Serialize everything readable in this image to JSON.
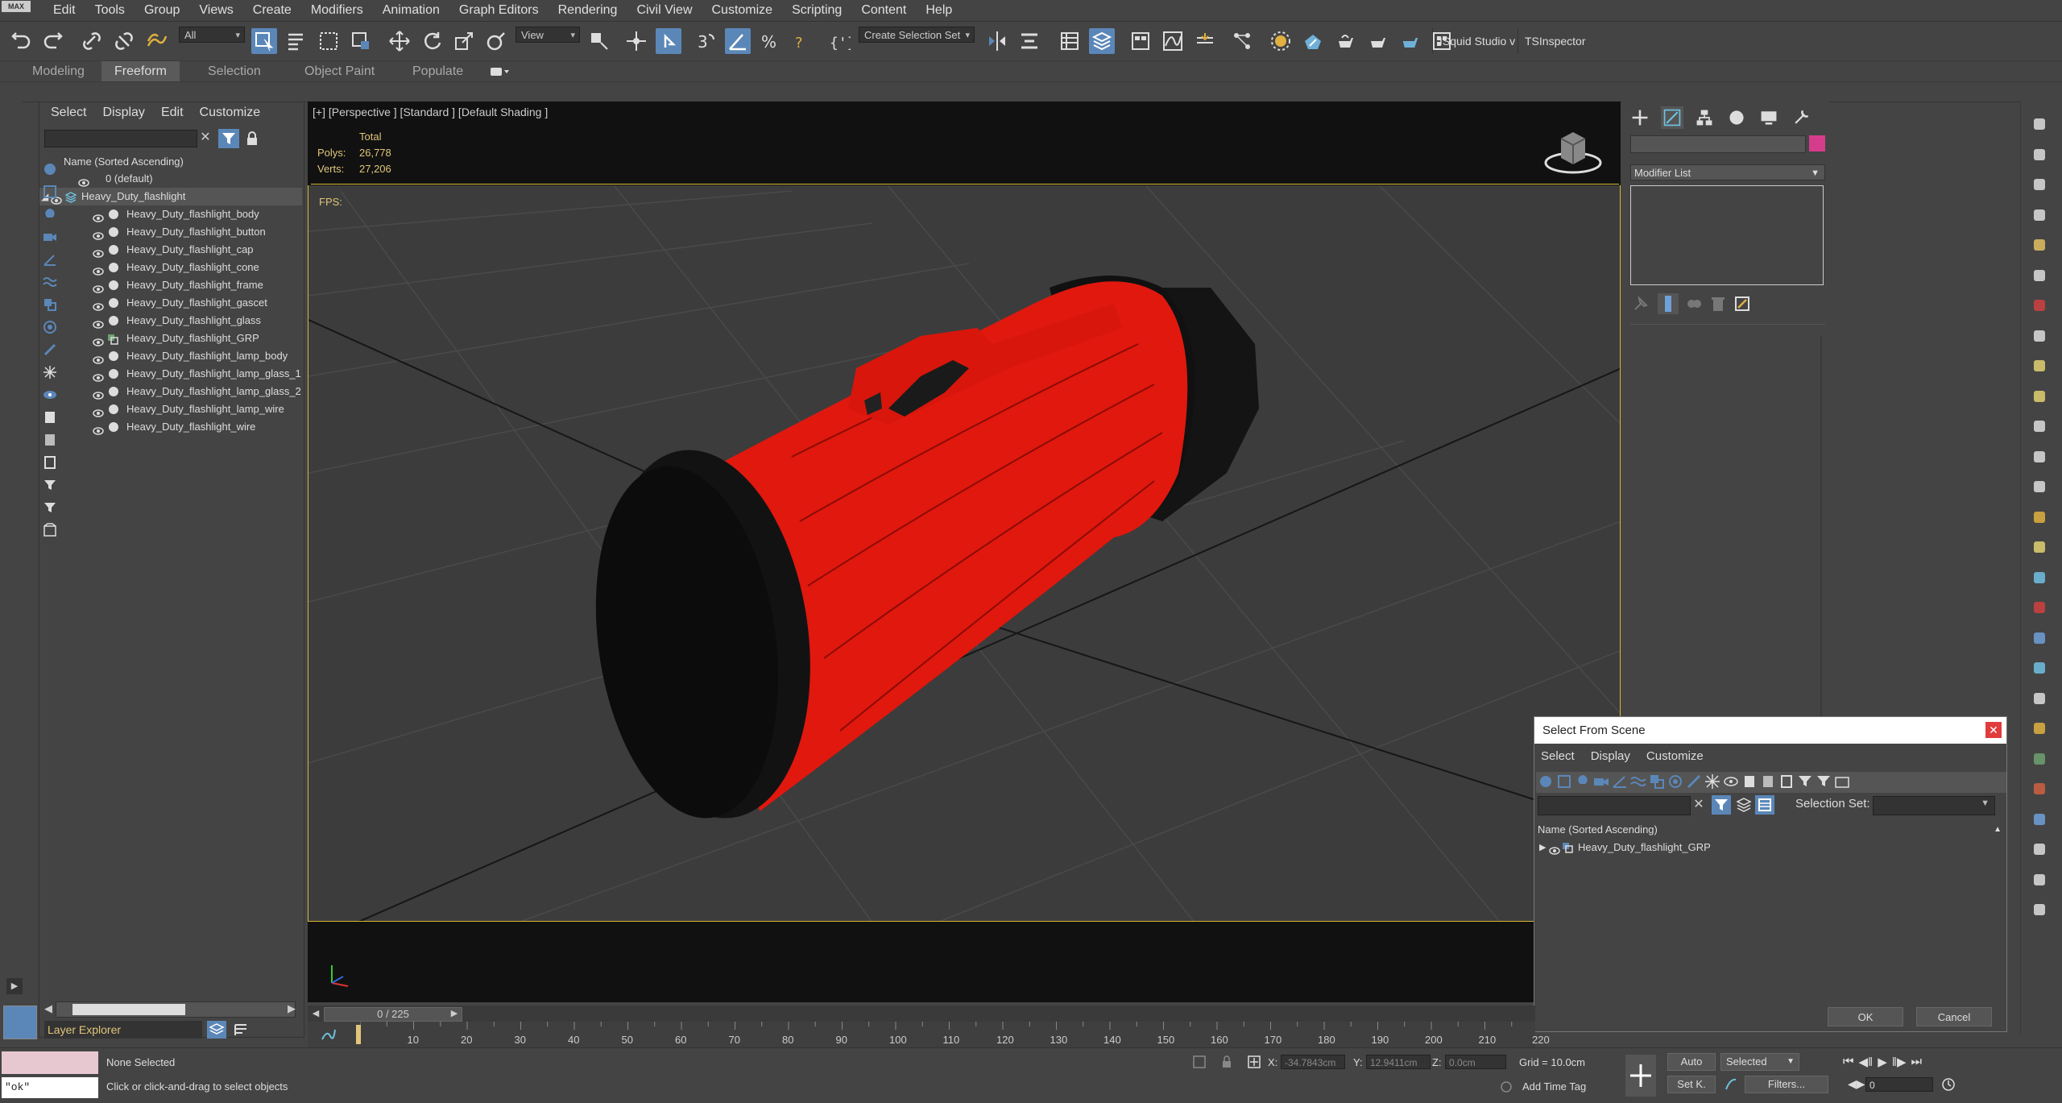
{
  "app": {
    "logo": "MAX"
  },
  "menu": [
    "Edit",
    "Tools",
    "Group",
    "Views",
    "Create",
    "Modifiers",
    "Animation",
    "Graph Editors",
    "Rendering",
    "Civil View",
    "Customize",
    "Scripting",
    "Content",
    "Help"
  ],
  "toolbar": {
    "filter_dropdown": "All",
    "ref_coord_dropdown": "View",
    "selection_set_dropdown": "Create Selection Set",
    "squid_studio": "ISquid Studio v",
    "tsinspector": "TSInspector"
  },
  "ribbon_tabs": [
    "Modeling",
    "Freeform",
    "Selection",
    "Object Paint",
    "Populate"
  ],
  "scene_explorer": {
    "menu": [
      "Select",
      "Display",
      "Edit",
      "Customize"
    ],
    "column_header": "Name (Sorted Ascending)",
    "rows": [
      {
        "label": "0 (default)",
        "indent": 0
      },
      {
        "label": "Heavy_Duty_flashlight",
        "indent": 1
      },
      {
        "label": "Heavy_Duty_flashlight_body",
        "indent": 2
      },
      {
        "label": "Heavy_Duty_flashlight_button",
        "indent": 2
      },
      {
        "label": "Heavy_Duty_flashlight_cap",
        "indent": 2
      },
      {
        "label": "Heavy_Duty_flashlight_cone",
        "indent": 2
      },
      {
        "label": "Heavy_Duty_flashlight_frame",
        "indent": 2
      },
      {
        "label": "Heavy_Duty_flashlight_gascet",
        "indent": 2
      },
      {
        "label": "Heavy_Duty_flashlight_glass",
        "indent": 2
      },
      {
        "label": "Heavy_Duty_flashlight_GRP",
        "indent": 2
      },
      {
        "label": "Heavy_Duty_flashlight_lamp_body",
        "indent": 2
      },
      {
        "label": "Heavy_Duty_flashlight_lamp_glass_1",
        "indent": 2
      },
      {
        "label": "Heavy_Duty_flashlight_lamp_glass_2",
        "indent": 2
      },
      {
        "label": "Heavy_Duty_flashlight_lamp_wire",
        "indent": 2
      },
      {
        "label": "Heavy_Duty_flashlight_wire",
        "indent": 2
      }
    ],
    "footer_label": "Layer Explorer"
  },
  "viewport": {
    "label": "[+] [Perspective ] [Standard ] [Default Shading ]",
    "stats_header": "Total",
    "polys_label": "Polys:",
    "polys_value": "26,778",
    "verts_label": "Verts:",
    "verts_value": "27,206",
    "fps_label": "FPS:"
  },
  "command_panel": {
    "modifier_list": "Modifier List",
    "swatch_color": "#d63c8c"
  },
  "dialog": {
    "title": "Select From Scene",
    "close": "✕",
    "menu": [
      "Select",
      "Display",
      "Customize"
    ],
    "selection_set_label": "Selection Set:",
    "column_header": "Name (Sorted Ascending)",
    "item": "Heavy_Duty_flashlight_GRP",
    "ok": "OK",
    "cancel": "Cancel"
  },
  "timeline": {
    "frame_counter": "0 / 225",
    "ticks": [
      "10",
      "20",
      "30",
      "40",
      "50",
      "60",
      "70",
      "80",
      "90",
      "100",
      "110",
      "120",
      "130",
      "140",
      "150",
      "160",
      "170",
      "180",
      "190",
      "200",
      "210",
      "220"
    ]
  },
  "status": {
    "script_field": "\"ok\"",
    "selection": "None Selected",
    "prompt": "Click or click-and-drag to select objects",
    "x_label": "X:",
    "x_value": "-34.7843cm",
    "y_label": "Y:",
    "y_value": "12.9411cm",
    "z_label": "Z:",
    "z_value": "0.0cm",
    "grid": "Grid = 10.0cm",
    "add_time_tag": "Add Time Tag",
    "auto": "Auto",
    "selected_dropdown": "Selected",
    "set_key": "Set K.",
    "filters": "Filters...",
    "frame_field": "0"
  }
}
